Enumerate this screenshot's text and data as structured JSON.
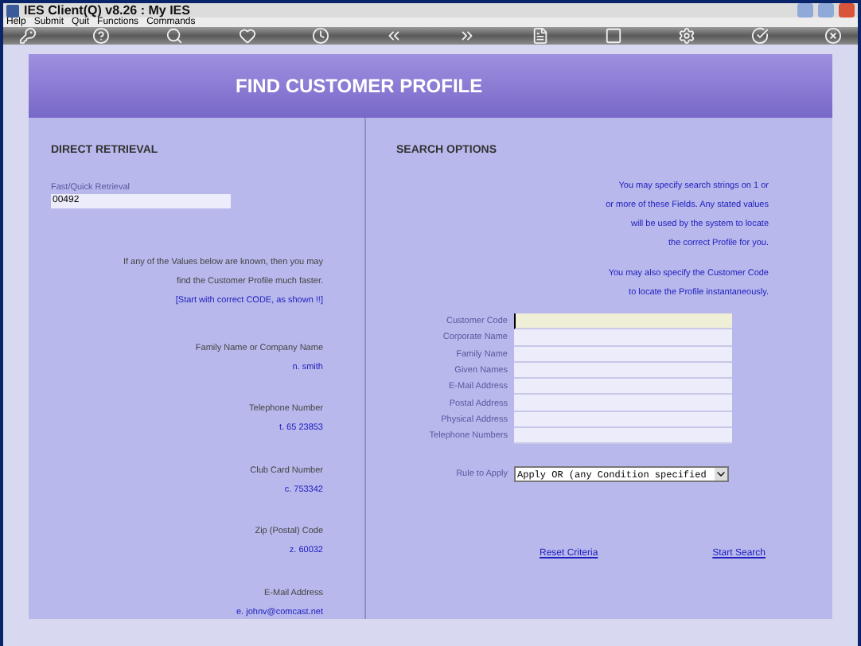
{
  "window": {
    "title": "IES Client(Q) v8.26 : My IES"
  },
  "menu": [
    "Help",
    "Submit",
    "Quit",
    "Functions",
    "Commands"
  ],
  "banner": {
    "title": "FIND CUSTOMER PROFILE"
  },
  "direct_retrieval": {
    "heading": "DIRECT RETRIEVAL",
    "field": {
      "label": "Fast/Quick Retrieval",
      "value": "00492"
    },
    "help_lines": [
      "If any of the Values below are known, then you may",
      "find the Customer Profile much faster."
    ],
    "help_link": "[Start with correct CODE, as shown !!]",
    "examples": [
      {
        "label": "Family Name or Company Name",
        "value": "n. smith"
      },
      {
        "label": "Telephone Number",
        "value": "t. 65 23853"
      },
      {
        "label": "Club Card Number",
        "value": "c. 753342"
      },
      {
        "label": "Zip (Postal) Code",
        "value": "z. 60032"
      },
      {
        "label": "E-Mail Address",
        "value": "e. johnv@comcast.net"
      }
    ]
  },
  "search_options": {
    "heading": "SEARCH OPTIONS",
    "help_blocks": [
      [
        "You may specify search strings on 1 or",
        "or more of these Fields. Any stated values",
        "will be used by the system to locate",
        "the correct Profile for you."
      ],
      [
        "You may also specify the Customer Code",
        "to locate the Profile instantaneously."
      ]
    ],
    "fields": [
      {
        "label": "Customer Code",
        "focused": true
      },
      {
        "label": "Corporate Name",
        "focused": false
      },
      {
        "label": "Family Name",
        "focused": false
      },
      {
        "label": "Given Names",
        "focused": false
      },
      {
        "label": "E-Mail Address",
        "focused": false
      },
      {
        "label": "Postal Address",
        "focused": false
      },
      {
        "label": "Physical Address",
        "focused": false
      },
      {
        "label": "Telephone Numbers",
        "focused": false
      }
    ],
    "rule": {
      "label": "Rule to Apply",
      "value": "Apply OR (any Condition specified"
    },
    "links": [
      "Reset Criteria",
      "Start Search"
    ]
  }
}
